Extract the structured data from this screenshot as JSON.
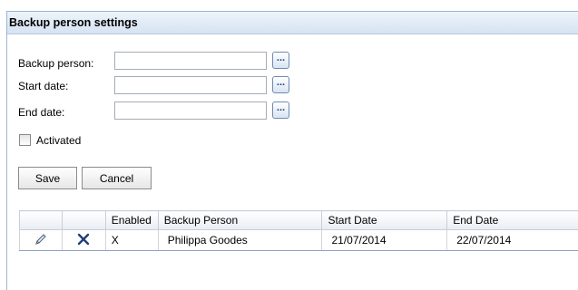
{
  "panel": {
    "title": "Backup person settings"
  },
  "form": {
    "backup_person": {
      "label": "Backup person:",
      "value": "",
      "picker_label": "..."
    },
    "start_date": {
      "label": "Start date:",
      "value": "",
      "picker_label": "..."
    },
    "end_date": {
      "label": "End date:",
      "value": "",
      "picker_label": "..."
    },
    "activated": {
      "label": "Activated",
      "checked": false
    }
  },
  "buttons": {
    "save": "Save",
    "cancel": "Cancel"
  },
  "grid": {
    "columns": [
      "",
      "",
      "Enabled",
      "Backup Person",
      "Start Date",
      "End Date"
    ],
    "rows": [
      {
        "edit_icon": "pencil-icon",
        "delete_icon": "delete-x-icon",
        "enabled": "X",
        "backup_person": "Philippa Goodes",
        "start_date": "21/07/2014",
        "end_date": "22/07/2014"
      }
    ]
  },
  "colors": {
    "title_bg": "#d6e3f2",
    "border_accent": "#9bb5d6",
    "delete_icon": "#1f3f77"
  }
}
